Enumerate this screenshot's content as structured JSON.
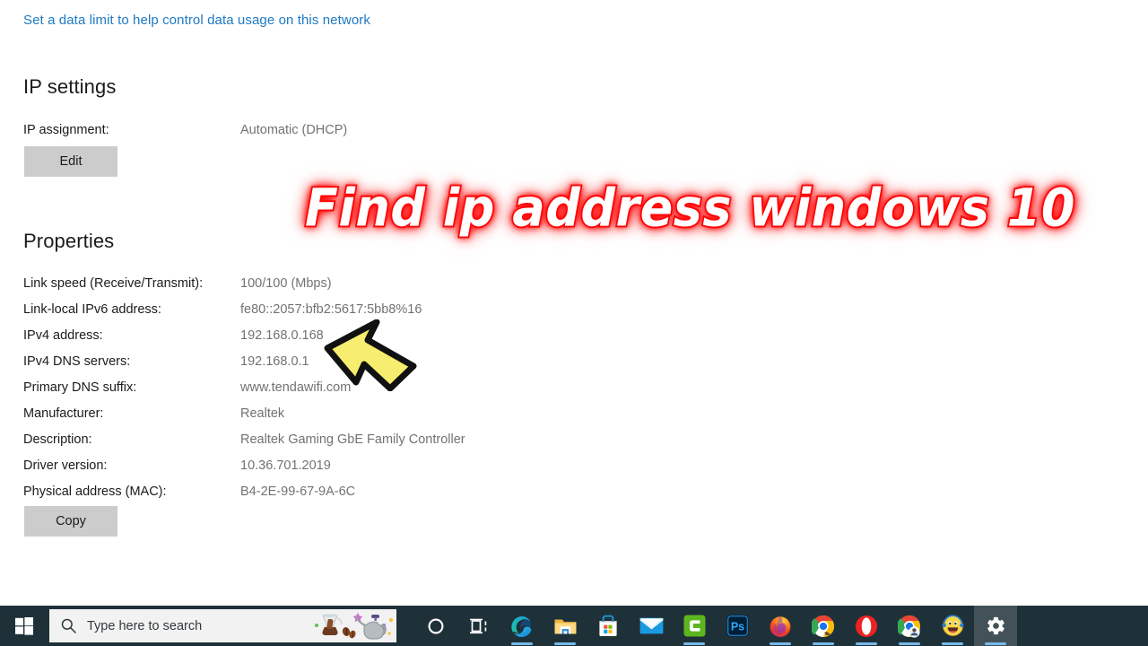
{
  "page": {
    "link_text": "Set a data limit to help control data usage on this network",
    "link_color": "#1e79c4",
    "background": "#ffffff"
  },
  "ip_settings": {
    "heading": "IP settings",
    "assignment_label": "IP assignment:",
    "assignment_value": "Automatic (DHCP)",
    "edit_button": "Edit"
  },
  "properties": {
    "heading": "Properties",
    "rows": [
      {
        "label": "Link speed (Receive/Transmit):",
        "value": "100/100 (Mbps)"
      },
      {
        "label": "Link-local IPv6 address:",
        "value": "fe80::2057:bfb2:5617:5bb8%16"
      },
      {
        "label": "IPv4 address:",
        "value": "192.168.0.168"
      },
      {
        "label": "IPv4 DNS servers:",
        "value": "192.168.0.1"
      },
      {
        "label": "Primary DNS suffix:",
        "value": "www.tendawifi.com"
      },
      {
        "label": "Manufacturer:",
        "value": "Realtek"
      },
      {
        "label": "Description:",
        "value": "Realtek Gaming GbE Family Controller"
      },
      {
        "label": "Driver version:",
        "value": "10.36.701.2019"
      },
      {
        "label": "Physical address (MAC):",
        "value": "B4-2E-99-67-9A-6C"
      }
    ],
    "copy_button": "Copy"
  },
  "overlay": {
    "title": "Find  ip  address windows 10",
    "fill_color": "#ffffff",
    "outline_color": "#f01010",
    "arrow_color": "#f7ee6f",
    "arrow_outline": "#111111"
  },
  "taskbar": {
    "background": "#1f3138",
    "start_label": "Start",
    "search_placeholder": "Type here to search",
    "search_icon": "search-icon",
    "items": [
      {
        "name": "cortana",
        "label": "Cortana",
        "running": false,
        "active": false
      },
      {
        "name": "task-view",
        "label": "Task View",
        "running": false,
        "active": false
      },
      {
        "name": "edge",
        "label": "Microsoft Edge",
        "running": true,
        "active": false
      },
      {
        "name": "file-explorer",
        "label": "File Explorer",
        "running": true,
        "active": false
      },
      {
        "name": "microsoft-store",
        "label": "Microsoft Store",
        "running": false,
        "active": false
      },
      {
        "name": "mail",
        "label": "Mail",
        "running": false,
        "active": false
      },
      {
        "name": "camtasia",
        "label": "Camtasia",
        "running": true,
        "active": false
      },
      {
        "name": "photoshop",
        "label": "Adobe Photoshop",
        "running": false,
        "active": false
      },
      {
        "name": "firefox",
        "label": "Mozilla Firefox",
        "running": true,
        "active": false
      },
      {
        "name": "chrome",
        "label": "Google Chrome",
        "running": true,
        "active": false
      },
      {
        "name": "opera",
        "label": "Opera",
        "running": true,
        "active": false
      },
      {
        "name": "chrome-profile",
        "label": "Google Chrome",
        "running": true,
        "active": false
      },
      {
        "name": "emoji-app",
        "label": "Emoji App",
        "running": true,
        "active": false
      },
      {
        "name": "settings",
        "label": "Settings",
        "running": true,
        "active": true
      }
    ]
  }
}
